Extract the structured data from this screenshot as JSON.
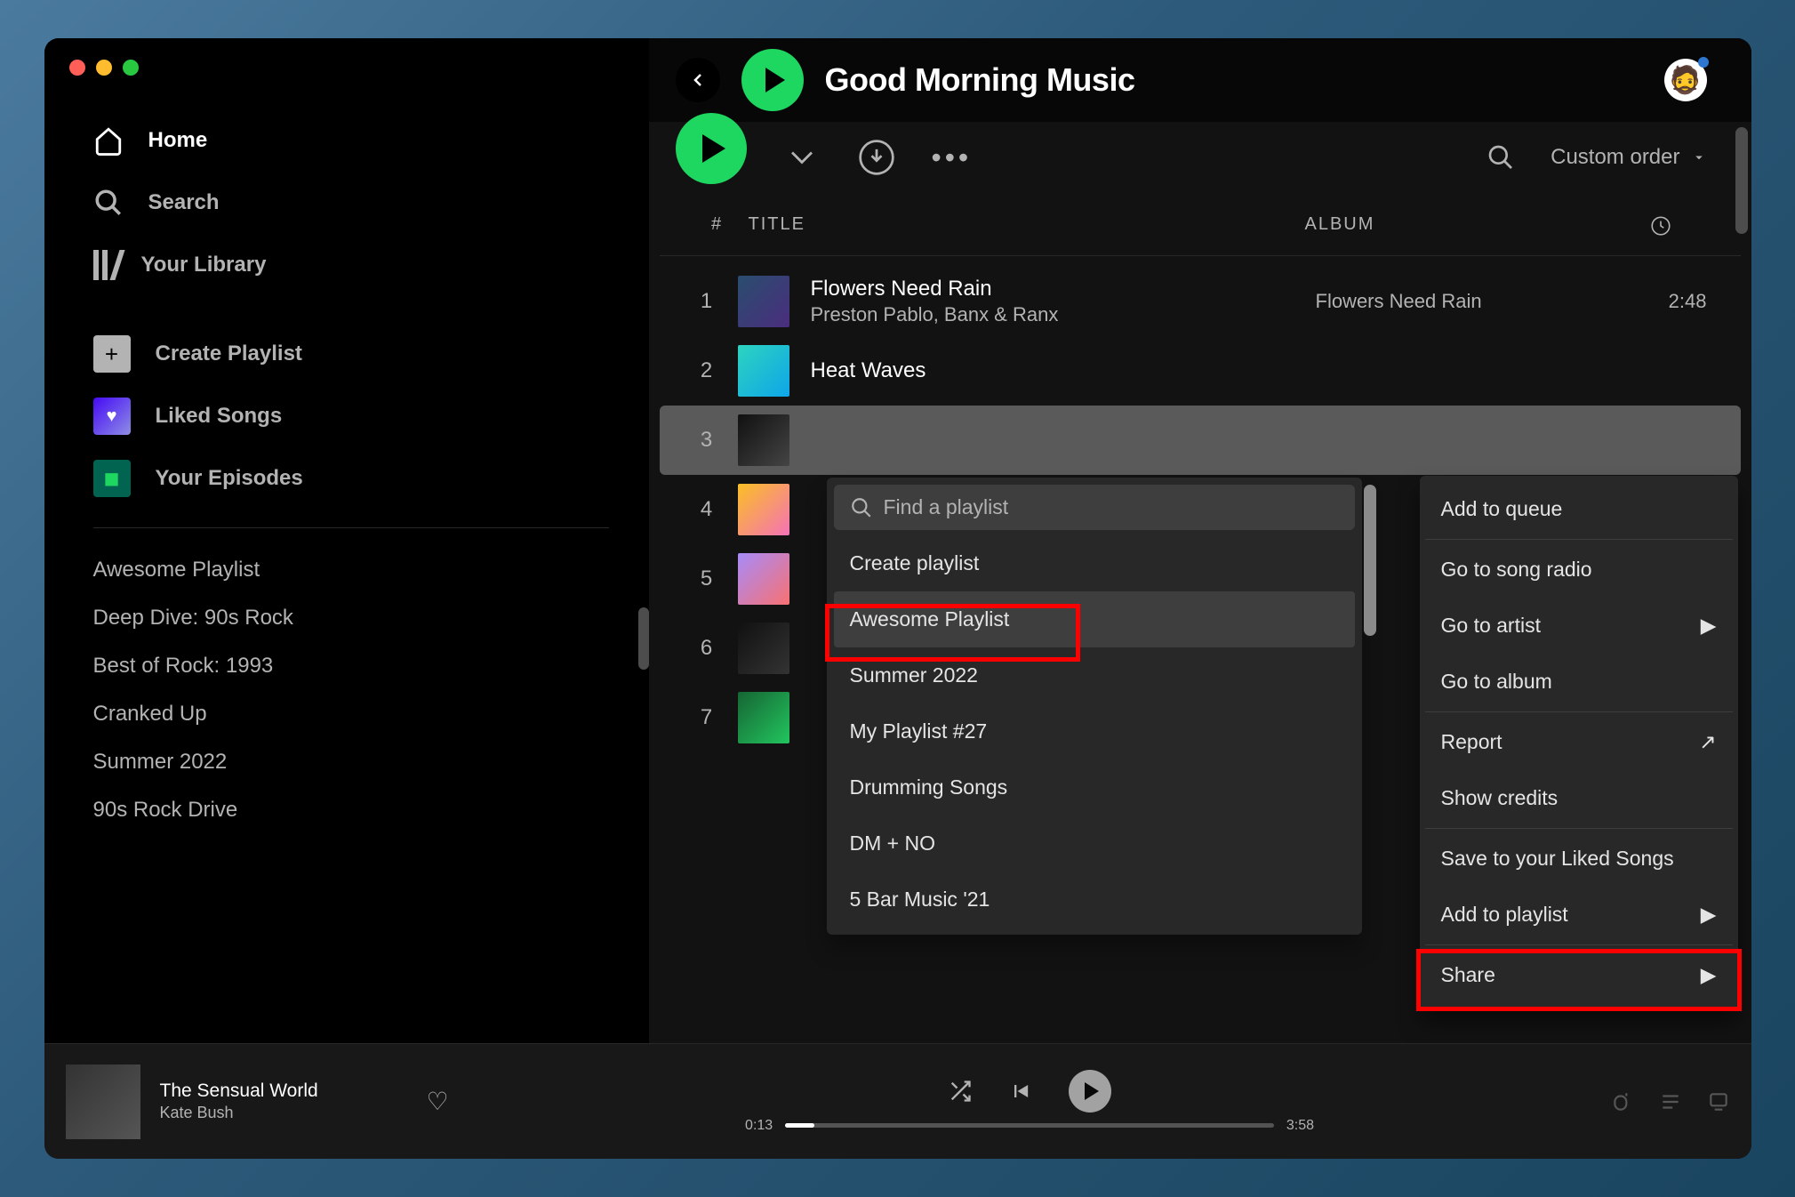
{
  "sidebar": {
    "nav": [
      {
        "label": "Home"
      },
      {
        "label": "Search"
      },
      {
        "label": "Your Library"
      }
    ],
    "create": "Create Playlist",
    "liked": "Liked Songs",
    "episodes": "Your Episodes",
    "playlists": [
      "Awesome Playlist",
      "Deep Dive: 90s Rock",
      "Best of Rock: 1993",
      "Cranked Up",
      "Summer 2022",
      "90s Rock Drive"
    ]
  },
  "header": {
    "title": "Good Morning Music",
    "sort_label": "Custom order"
  },
  "columns": {
    "num": "#",
    "title": "TITLE",
    "album": "ALBUM"
  },
  "tracks": [
    {
      "num": "1",
      "title": "Flowers Need Rain",
      "artist": "Preston Pablo, Banx & Ranx",
      "album": "Flowers Need Rain",
      "duration": "2:48"
    },
    {
      "num": "2",
      "title": "Heat Waves",
      "artist": "",
      "album": "",
      "duration": ""
    },
    {
      "num": "3",
      "title": "",
      "artist": "",
      "album": "",
      "duration": ""
    },
    {
      "num": "4",
      "title": "",
      "artist": "",
      "album": "",
      "duration": ""
    },
    {
      "num": "5",
      "title": "",
      "artist": "",
      "album": "",
      "duration": ""
    },
    {
      "num": "6",
      "title": "",
      "artist": "",
      "album": "",
      "duration": ""
    },
    {
      "num": "7",
      "title": "",
      "artist": "",
      "album": "",
      "duration": ""
    }
  ],
  "submenu": {
    "placeholder": "Find a playlist",
    "create": "Create playlist",
    "items": [
      "Awesome Playlist",
      "Summer 2022",
      "My Playlist #27",
      "Drumming Songs",
      "DM + NO",
      "5 Bar Music '21"
    ]
  },
  "context_menu": [
    "Add to queue",
    "Go to song radio",
    "Go to artist",
    "Go to album",
    "Report",
    "Show credits",
    "Save to your Liked Songs",
    "Add to playlist",
    "Share"
  ],
  "now_playing": {
    "title": "The Sensual World",
    "artist": "Kate Bush",
    "elapsed": "0:13",
    "total": "3:58"
  }
}
